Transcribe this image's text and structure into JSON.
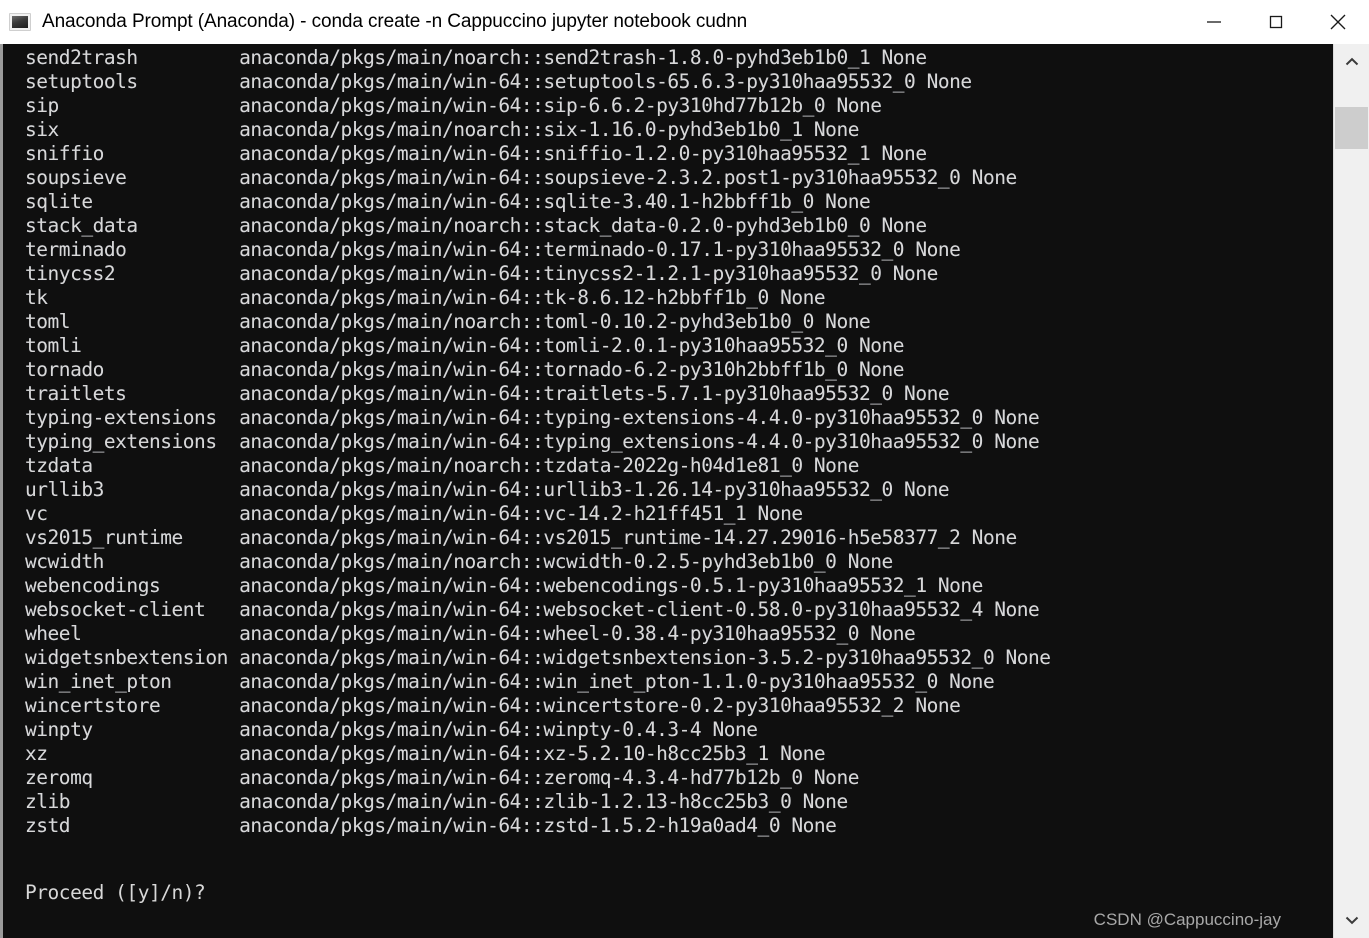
{
  "window": {
    "title": "Anaconda Prompt (Anaconda) - conda  create -n Cappuccino jupyter notebook cudnn",
    "icon": "console-icon",
    "minimize_label": "–",
    "maximize_label": "□",
    "close_label": "✕"
  },
  "terminal": {
    "background_color": "#0f0f0f",
    "text_color": "#d8d8d8",
    "columns": {
      "name_start_col": 0,
      "spec_start_col": 19
    },
    "rows": [
      {
        "package": "send2trash",
        "spec": "anaconda/pkgs/main/noarch::send2trash-1.8.0-pyhd3eb1b0_1",
        "channel": "None"
      },
      {
        "package": "setuptools",
        "spec": "anaconda/pkgs/main/win-64::setuptools-65.6.3-py310haa95532_0",
        "channel": "None"
      },
      {
        "package": "sip",
        "spec": "anaconda/pkgs/main/win-64::sip-6.6.2-py310hd77b12b_0",
        "channel": "None"
      },
      {
        "package": "six",
        "spec": "anaconda/pkgs/main/noarch::six-1.16.0-pyhd3eb1b0_1",
        "channel": "None"
      },
      {
        "package": "sniffio",
        "spec": "anaconda/pkgs/main/win-64::sniffio-1.2.0-py310haa95532_1",
        "channel": "None"
      },
      {
        "package": "soupsieve",
        "spec": "anaconda/pkgs/main/win-64::soupsieve-2.3.2.post1-py310haa95532_0",
        "channel": "None"
      },
      {
        "package": "sqlite",
        "spec": "anaconda/pkgs/main/win-64::sqlite-3.40.1-h2bbff1b_0",
        "channel": "None"
      },
      {
        "package": "stack_data",
        "spec": "anaconda/pkgs/main/noarch::stack_data-0.2.0-pyhd3eb1b0_0",
        "channel": "None"
      },
      {
        "package": "terminado",
        "spec": "anaconda/pkgs/main/win-64::terminado-0.17.1-py310haa95532_0",
        "channel": "None"
      },
      {
        "package": "tinycss2",
        "spec": "anaconda/pkgs/main/win-64::tinycss2-1.2.1-py310haa95532_0",
        "channel": "None"
      },
      {
        "package": "tk",
        "spec": "anaconda/pkgs/main/win-64::tk-8.6.12-h2bbff1b_0",
        "channel": "None"
      },
      {
        "package": "toml",
        "spec": "anaconda/pkgs/main/noarch::toml-0.10.2-pyhd3eb1b0_0",
        "channel": "None"
      },
      {
        "package": "tomli",
        "spec": "anaconda/pkgs/main/win-64::tomli-2.0.1-py310haa95532_0",
        "channel": "None"
      },
      {
        "package": "tornado",
        "spec": "anaconda/pkgs/main/win-64::tornado-6.2-py310h2bbff1b_0",
        "channel": "None"
      },
      {
        "package": "traitlets",
        "spec": "anaconda/pkgs/main/win-64::traitlets-5.7.1-py310haa95532_0",
        "channel": "None"
      },
      {
        "package": "typing-extensions",
        "spec": "anaconda/pkgs/main/win-64::typing-extensions-4.4.0-py310haa95532_0",
        "channel": "None"
      },
      {
        "package": "typing_extensions",
        "spec": "anaconda/pkgs/main/win-64::typing_extensions-4.4.0-py310haa95532_0",
        "channel": "None"
      },
      {
        "package": "tzdata",
        "spec": "anaconda/pkgs/main/noarch::tzdata-2022g-h04d1e81_0",
        "channel": "None"
      },
      {
        "package": "urllib3",
        "spec": "anaconda/pkgs/main/win-64::urllib3-1.26.14-py310haa95532_0",
        "channel": "None"
      },
      {
        "package": "vc",
        "spec": "anaconda/pkgs/main/win-64::vc-14.2-h21ff451_1",
        "channel": "None"
      },
      {
        "package": "vs2015_runtime",
        "spec": "anaconda/pkgs/main/win-64::vs2015_runtime-14.27.29016-h5e58377_2",
        "channel": "None"
      },
      {
        "package": "wcwidth",
        "spec": "anaconda/pkgs/main/noarch::wcwidth-0.2.5-pyhd3eb1b0_0",
        "channel": "None"
      },
      {
        "package": "webencodings",
        "spec": "anaconda/pkgs/main/win-64::webencodings-0.5.1-py310haa95532_1",
        "channel": "None"
      },
      {
        "package": "websocket-client",
        "spec": "anaconda/pkgs/main/win-64::websocket-client-0.58.0-py310haa95532_4",
        "channel": "None"
      },
      {
        "package": "wheel",
        "spec": "anaconda/pkgs/main/win-64::wheel-0.38.4-py310haa95532_0",
        "channel": "None"
      },
      {
        "package": "widgetsnbextension",
        "spec": "anaconda/pkgs/main/win-64::widgetsnbextension-3.5.2-py310haa95532_0",
        "channel": "None"
      },
      {
        "package": "win_inet_pton",
        "spec": "anaconda/pkgs/main/win-64::win_inet_pton-1.1.0-py310haa95532_0",
        "channel": "None"
      },
      {
        "package": "wincertstore",
        "spec": "anaconda/pkgs/main/win-64::wincertstore-0.2-py310haa95532_2",
        "channel": "None"
      },
      {
        "package": "winpty",
        "spec": "anaconda/pkgs/main/win-64::winpty-0.4.3-4",
        "channel": "None"
      },
      {
        "package": "xz",
        "spec": "anaconda/pkgs/main/win-64::xz-5.2.10-h8cc25b3_1",
        "channel": "None"
      },
      {
        "package": "zeromq",
        "spec": "anaconda/pkgs/main/win-64::zeromq-4.3.4-hd77b12b_0",
        "channel": "None"
      },
      {
        "package": "zlib",
        "spec": "anaconda/pkgs/main/win-64::zlib-1.2.13-h8cc25b3_0",
        "channel": "None"
      },
      {
        "package": "zstd",
        "spec": "anaconda/pkgs/main/win-64::zstd-1.5.2-h19a0ad4_0",
        "channel": "None"
      }
    ],
    "prompt": "Proceed ([y]/n)?"
  },
  "watermark": {
    "text": "CSDN @Cappuccino-jay"
  },
  "scrollbar": {
    "up_arrow": "chevron-up-icon",
    "down_arrow": "chevron-down-icon",
    "thumb_position_percent": 3
  }
}
